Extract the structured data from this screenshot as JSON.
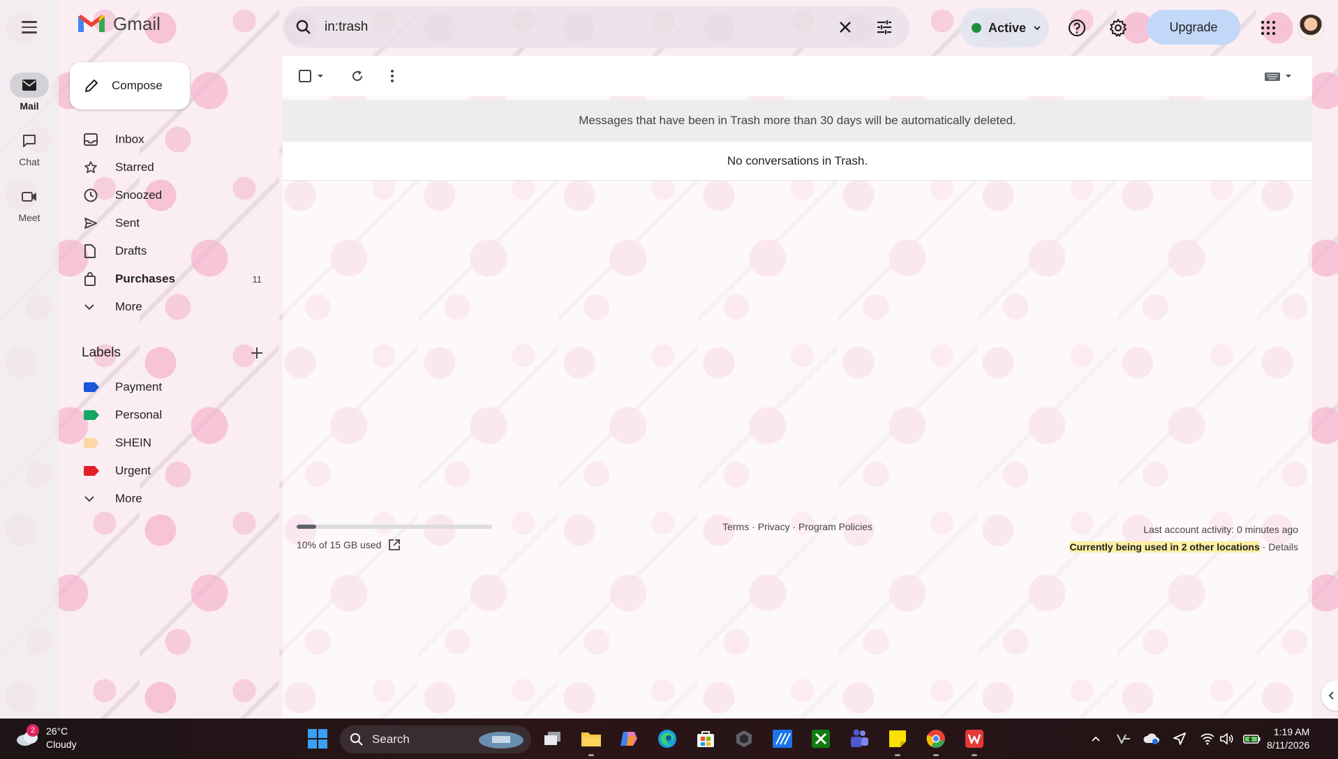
{
  "rail": {
    "items": [
      {
        "label": "Mail",
        "icon": "mail-icon"
      },
      {
        "label": "Chat",
        "icon": "chat-icon"
      },
      {
        "label": "Meet",
        "icon": "video-icon"
      }
    ]
  },
  "app": {
    "name": "Gmail"
  },
  "search": {
    "query": "in:trash"
  },
  "status": {
    "label": "Active",
    "color": "#1e8e3e"
  },
  "header": {
    "upgrade_label": "Upgrade"
  },
  "compose": {
    "label": "Compose"
  },
  "nav": {
    "items": [
      {
        "label": "Inbox",
        "icon": "inbox-icon"
      },
      {
        "label": "Starred",
        "icon": "star-icon"
      },
      {
        "label": "Snoozed",
        "icon": "clock-icon"
      },
      {
        "label": "Sent",
        "icon": "send-icon"
      },
      {
        "label": "Drafts",
        "icon": "draft-icon"
      },
      {
        "label": "Purchases",
        "icon": "shopping-bag-icon",
        "count": "11"
      },
      {
        "label": "More",
        "icon": "chevron-down-icon"
      }
    ]
  },
  "labels": {
    "title": "Labels",
    "items": [
      {
        "label": "Payment",
        "color": "#1a56db"
      },
      {
        "label": "Personal",
        "color": "#16a765"
      },
      {
        "label": "SHEIN",
        "color": "#fad8a6"
      },
      {
        "label": "Urgent",
        "color": "#e21f26"
      }
    ],
    "more_label": "More"
  },
  "main": {
    "notice": "Messages that have been in Trash more than 30 days will be automatically deleted.",
    "empty_text": "No conversations in Trash."
  },
  "footer": {
    "storage_text": "10% of 15 GB used",
    "storage_fraction": 0.1,
    "terms": "Terms",
    "privacy": "Privacy",
    "policies": "Program Policies",
    "sep": " · ",
    "last_activity": "Last account activity: 0 minutes ago",
    "locations": "Currently being used in 2 other locations",
    "details": "Details"
  },
  "taskbar": {
    "weather": {
      "temp": "26°C",
      "condition": "Cloudy",
      "badge": "2"
    },
    "search_label": "Search",
    "time": "1:19 AM",
    "date": "8/11/2026"
  }
}
